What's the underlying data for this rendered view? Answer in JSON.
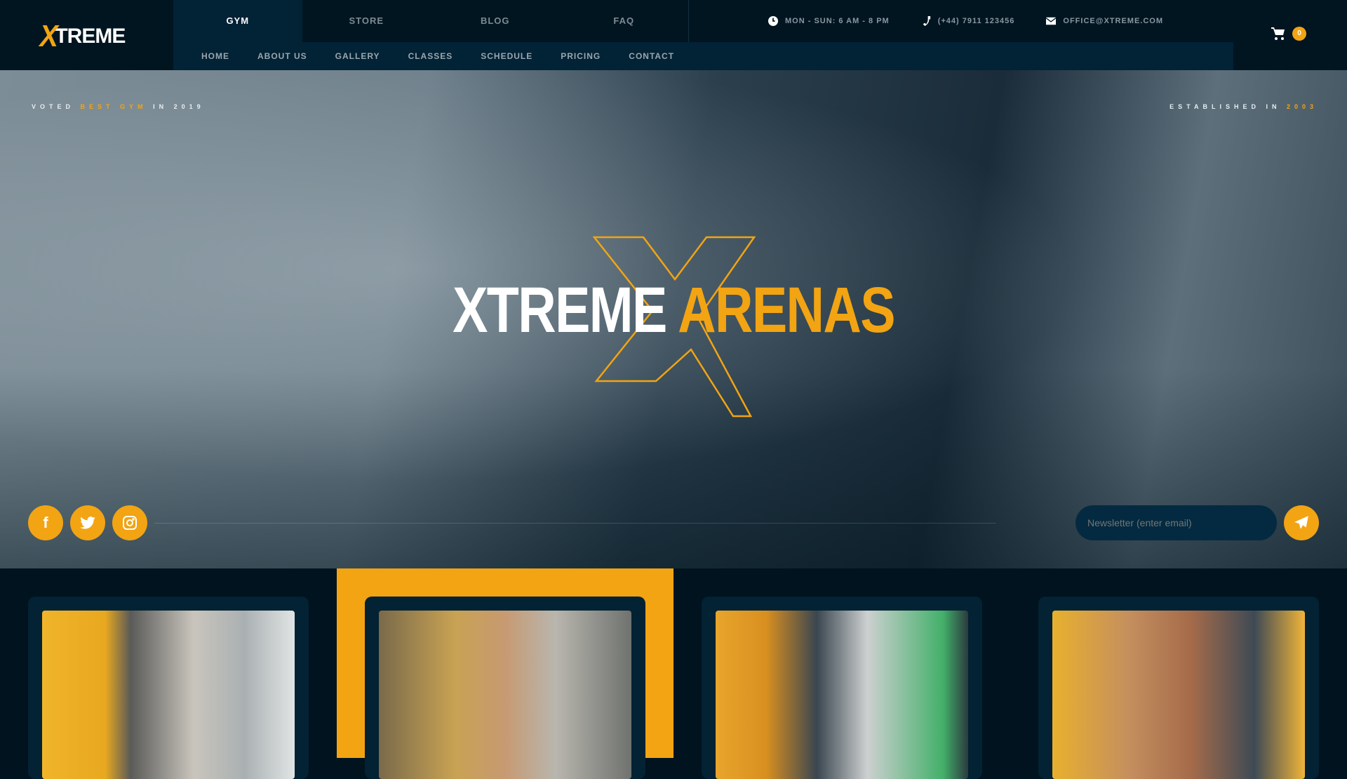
{
  "brand": {
    "logo_x": "X",
    "logo_rest": "TREME"
  },
  "topnav": [
    "GYM",
    "STORE",
    "BLOG",
    "FAQ"
  ],
  "subnav": [
    "HOME",
    "ABOUT US",
    "GALLERY",
    "CLASSES",
    "SCHEDULE",
    "PRICING",
    "CONTACT"
  ],
  "info": {
    "hours": "MON - SUN: 6 AM - 8 PM",
    "phone": "(+44) 7911 123456",
    "email": "OFFICE@XTREME.COM"
  },
  "cart": {
    "count": "0"
  },
  "hero": {
    "voted_pre": "VOTED",
    "voted_hl": "BEST GYM",
    "voted_post": "IN 2019",
    "est_pre": "ESTABLISHED IN",
    "est_year": "2003",
    "title_white": "XTREME",
    "title_yellow": "ARENAS",
    "newsletter_placeholder": "Newsletter (enter email)"
  },
  "colors": {
    "accent": "#f2a413",
    "dark": "#011520",
    "navy": "#022235"
  }
}
